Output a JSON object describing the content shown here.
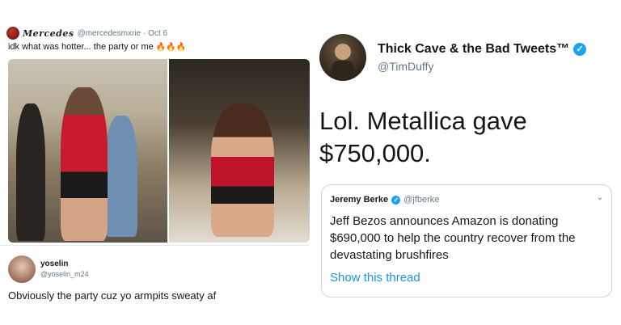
{
  "left_tweet": {
    "brand": "Mercedes",
    "handle": "@mercedesmxrie",
    "date": "· Oct 6",
    "text": "idk what was hotter... the party or me",
    "emoji": "🔥🔥🔥",
    "reply": {
      "name": "yoselin",
      "handle": "@yoselin_m24",
      "text": "Obviously the party cuz yo armpits sweaty af"
    }
  },
  "right_tweet": {
    "name": "Thick Cave & the Bad Tweets™",
    "handle": "@TimDuffy",
    "text": "Lol. Metallica gave $750,000.",
    "quote": {
      "name": "Jeremy Berke",
      "handle": "@jfberke",
      "text": "Jeff Bezos announces Amazon is donating $690,000 to help the country recover from the devastating brushfires",
      "link": "Show this thread"
    }
  },
  "colors": {
    "verified_blue": "#1da1f2",
    "link_blue": "#1b95e0",
    "muted_gray": "#657786"
  }
}
